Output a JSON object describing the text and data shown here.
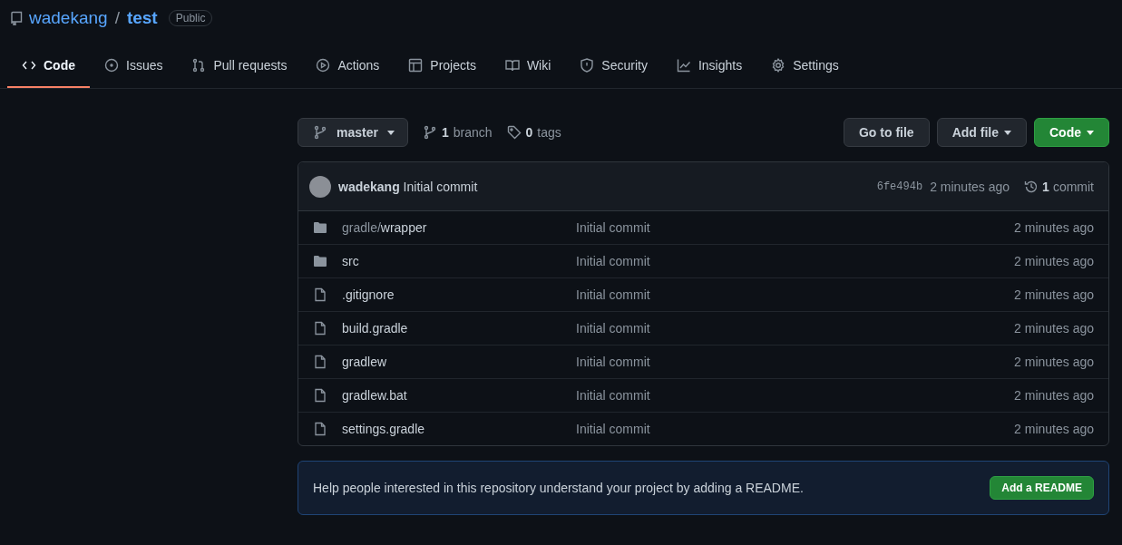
{
  "repo": {
    "owner": "wadekang",
    "separator": "/",
    "name": "test",
    "visibility": "Public"
  },
  "tabs": [
    {
      "label": "Code",
      "kind": "code",
      "selected": true
    },
    {
      "label": "Issues",
      "kind": "issue",
      "selected": false
    },
    {
      "label": "Pull requests",
      "kind": "pr",
      "selected": false
    },
    {
      "label": "Actions",
      "kind": "play",
      "selected": false
    },
    {
      "label": "Projects",
      "kind": "table",
      "selected": false
    },
    {
      "label": "Wiki",
      "kind": "book",
      "selected": false
    },
    {
      "label": "Security",
      "kind": "shield",
      "selected": false
    },
    {
      "label": "Insights",
      "kind": "graph",
      "selected": false
    },
    {
      "label": "Settings",
      "kind": "gear",
      "selected": false
    }
  ],
  "toolbar": {
    "branch": "master",
    "branch_count": "1",
    "branch_word": "branch",
    "tag_count": "0",
    "tag_word": "tags",
    "buttons": [
      {
        "label": "Go to file",
        "kind": "plain"
      },
      {
        "label": "Add file",
        "kind": "dropdown"
      },
      {
        "label": "Code",
        "kind": "primary"
      }
    ]
  },
  "commit": {
    "author": "wadekang",
    "message": "Initial commit",
    "sha": "6fe494b",
    "time": "2 minutes ago",
    "count": "1",
    "count_word": "commit"
  },
  "files": [
    {
      "kind": "folder",
      "prefix": "gradle/",
      "name": "wrapper",
      "message": "Initial commit",
      "time": "2 minutes ago"
    },
    {
      "kind": "folder",
      "name": "src",
      "message": "Initial commit",
      "time": "2 minutes ago"
    },
    {
      "kind": "file",
      "name": ".gitignore",
      "message": "Initial commit",
      "time": "2 minutes ago"
    },
    {
      "kind": "file",
      "name": "build.gradle",
      "message": "Initial commit",
      "time": "2 minutes ago"
    },
    {
      "kind": "file",
      "name": "gradlew",
      "message": "Initial commit",
      "time": "2 minutes ago"
    },
    {
      "kind": "file",
      "name": "gradlew.bat",
      "message": "Initial commit",
      "time": "2 minutes ago"
    },
    {
      "kind": "file",
      "name": "settings.gradle",
      "message": "Initial commit",
      "time": "2 minutes ago"
    }
  ],
  "readme_banner": {
    "text": "Help people interested in this repository understand your project by adding a README.",
    "button": "Add a README"
  }
}
